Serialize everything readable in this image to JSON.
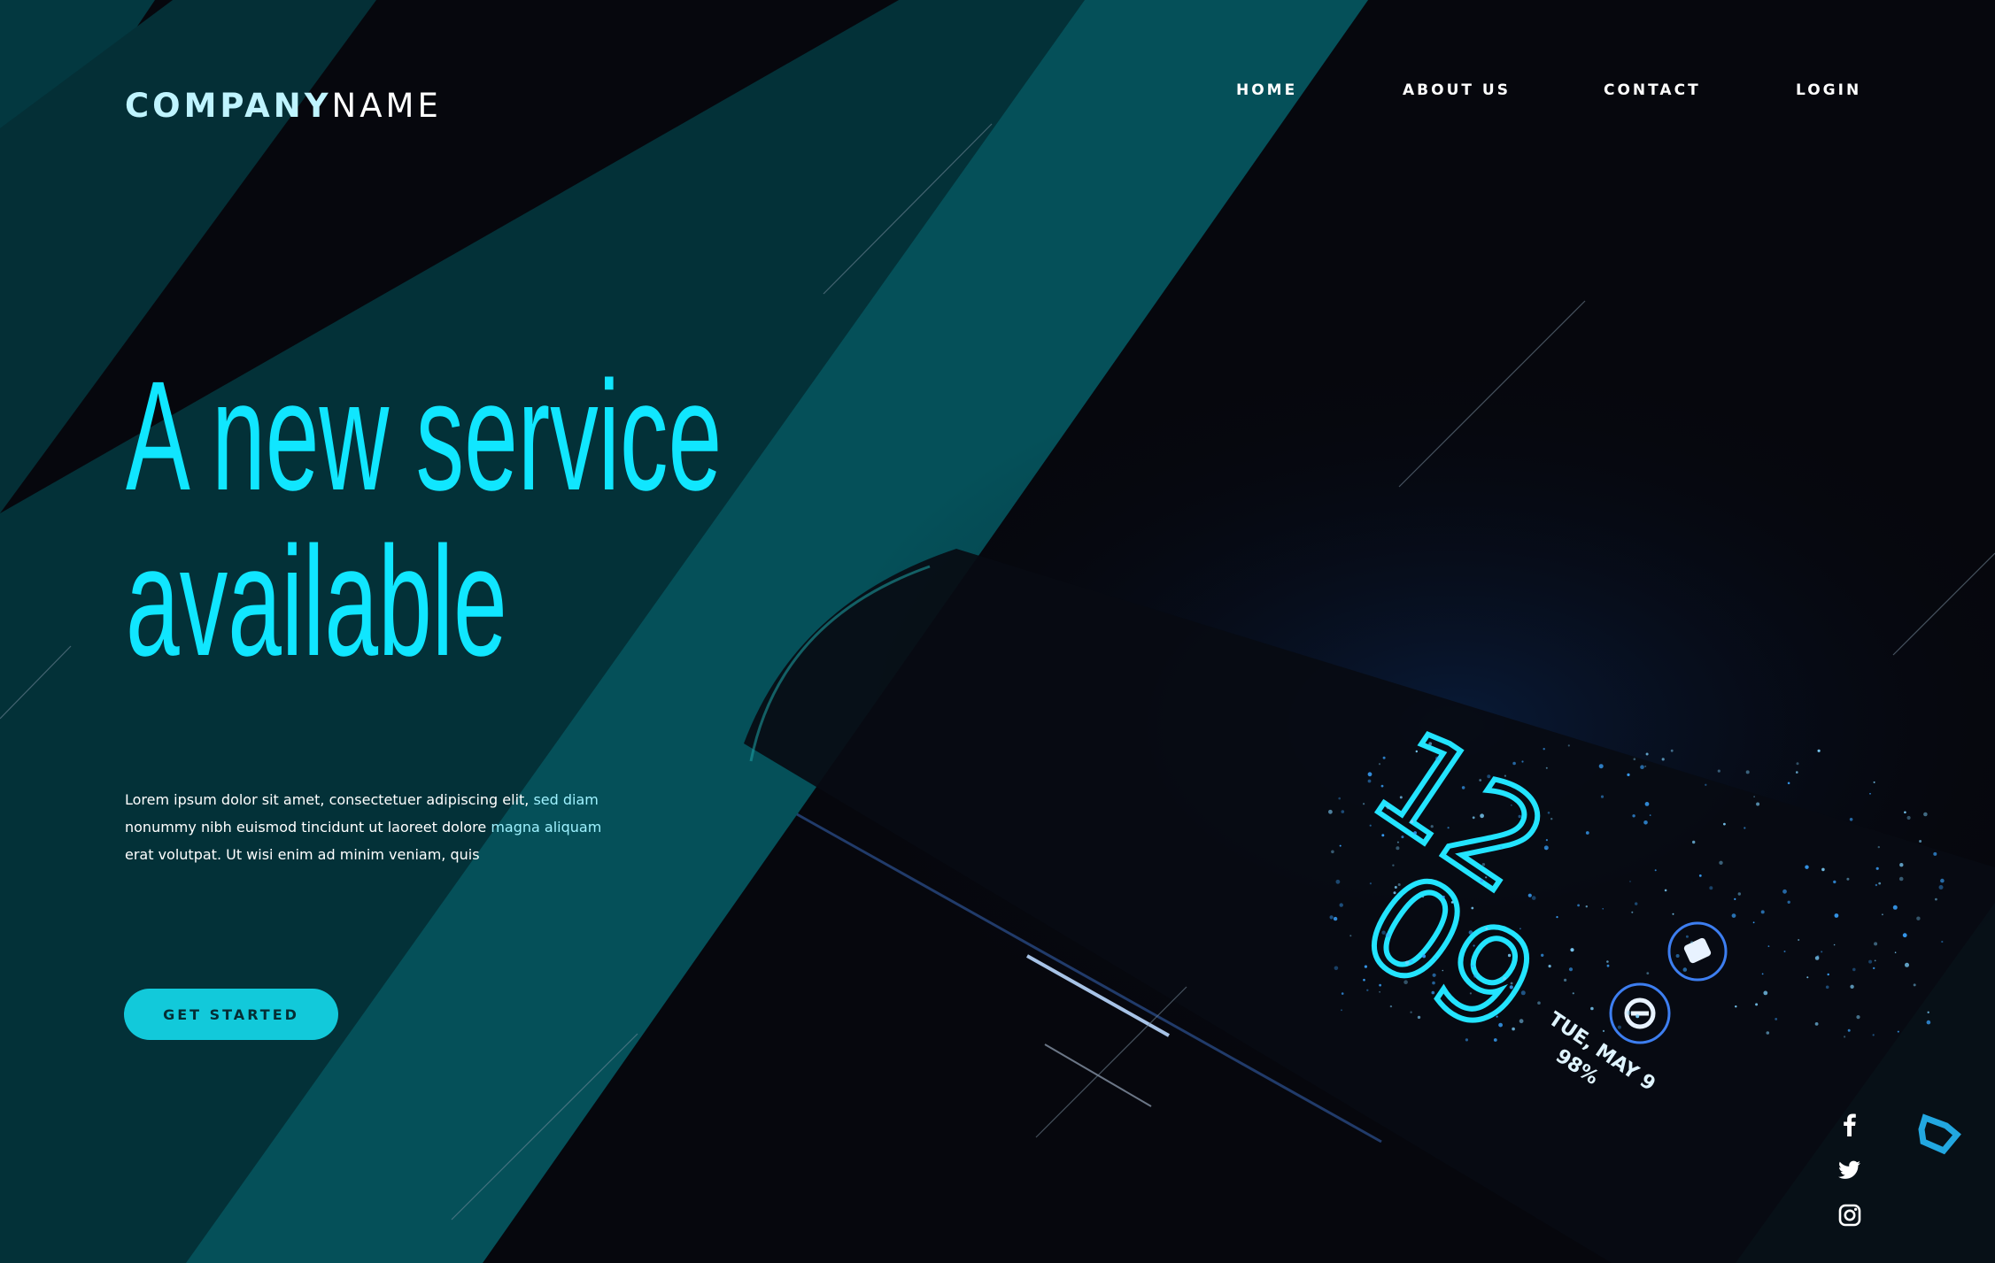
{
  "header": {
    "logo_bold": "COMPANY",
    "logo_light": "NAME",
    "nav": [
      {
        "label": "HOME"
      },
      {
        "label": "ABOUT US"
      },
      {
        "label": "CONTACT"
      },
      {
        "label": "LOGIN"
      }
    ]
  },
  "hero": {
    "headline_line1": "A new service",
    "headline_line2": "available",
    "body_lines": [
      {
        "text": "Lorem ipsum dolor sit amet, consectetuer adipiscing elit, ",
        "highlight": "sed diam"
      },
      {
        "text": "nonummy nibh euismod tincidunt ut laoreet dolore ",
        "highlight": "magna aliquam"
      },
      {
        "text": "erat volutpat. Ut wisi enim ad minim veniam, quis",
        "highlight": ""
      }
    ],
    "cta_label": "GET STARTED"
  },
  "phone_screen": {
    "hour": "12",
    "minute": "09",
    "date": "TUE, MAY 9",
    "battery": "98%"
  },
  "social": {
    "icons": [
      "facebook-icon",
      "twitter-icon",
      "instagram-icon"
    ]
  },
  "colors": {
    "background": "#06070d",
    "accent": "#10e6ff",
    "button": "#12c9da",
    "stripe_teal": "#055059",
    "stripe_dark": "#033138"
  }
}
